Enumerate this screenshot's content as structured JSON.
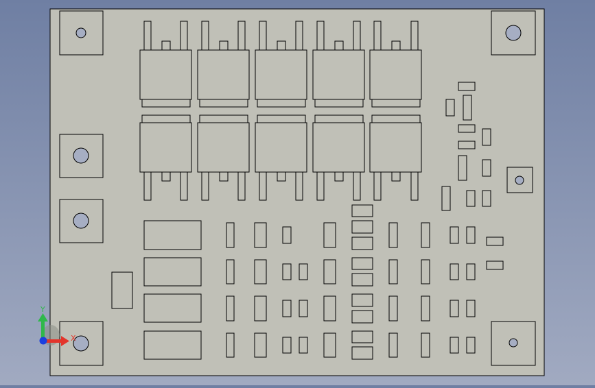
{
  "viewport": {
    "background_top": "#6f7fa3",
    "background_bottom": "#a1aac1"
  },
  "board": {
    "face_color": "#c0c0b7",
    "edge_color": "#000000"
  },
  "triad": {
    "y_label": "Y",
    "x_label": "X",
    "y_color": "#2fb84b",
    "x_color": "#e3352b",
    "z_color": "#1b3fe0"
  }
}
